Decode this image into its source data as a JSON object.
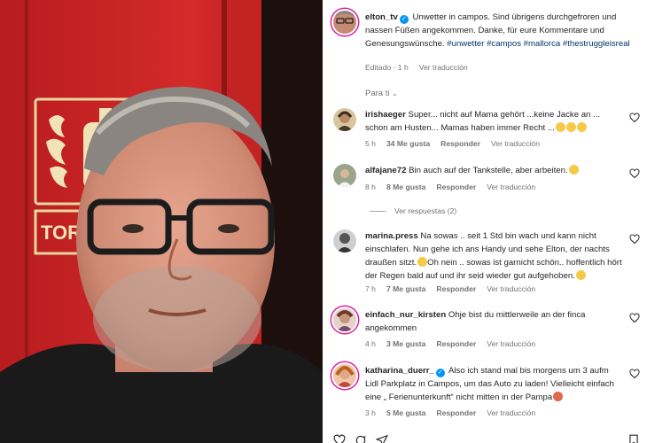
{
  "post": {
    "username": "elton_tv",
    "caption": "Unwetter in campos. Sind übrigens durchgefroren und nassen Füßen angekommen. Danke, für eure Kommentare und Genesungswünsche.",
    "hashtags": "#unwetter #campos #mallorca #thestruggleisreal",
    "edited_time": "Editado · 1 h",
    "see_translation": "Ver traducción"
  },
  "sort": {
    "label": "Para ti"
  },
  "sign": {
    "text": "TOR"
  },
  "comments": [
    {
      "username": "irishaeger",
      "text": "Super... nicht auf Mama gehört ...keine Jacke an ... schon am Husten... Mamas haben immer Recht ...",
      "time": "5 h",
      "likes": "34 Me gusta",
      "reply": "Responder",
      "translate": "Ver traducción"
    },
    {
      "username": "alfajane72",
      "text": "Bin auch auf der Tankstelle, aber arbeiten.",
      "time": "8 h",
      "likes": "8 Me gusta",
      "reply": "Responder",
      "translate": "Ver traducción",
      "view_replies": "Ver respuestas (2)"
    },
    {
      "username": "marina.press",
      "text": "Na sowas .. seit 1 Std bin wach und kann nicht einschlafen. Nun gehe ich ans Handy und sehe Elton, der nachts draußen sitzt.",
      "text2": "Oh nein .. sowas ist garnicht schön.. hoffentlich hört der Regen bald auf und ihr seid wieder gut aufgehoben.",
      "time": "7 h",
      "likes": "7 Me gusta",
      "reply": "Responder",
      "translate": "Ver traducción"
    },
    {
      "username": "einfach_nur_kirsten",
      "text": "Ohje bist du mittlerweile an der finca angekommen",
      "time": "4 h",
      "likes": "3 Me gusta",
      "reply": "Responder",
      "translate": "Ver traducción"
    },
    {
      "username": "katharina_duerr_",
      "text": "Also ich stand mal bis morgens um 3 aufm Lidl Parkplatz in Campos, um das Auto zu laden! Vielleicht einfach eine „ Ferienunterkunft“ nicht mitten in der Pampa",
      "time": "3 h",
      "likes": "5 Me gusta",
      "reply": "Responder",
      "translate": "Ver traducción"
    }
  ]
}
